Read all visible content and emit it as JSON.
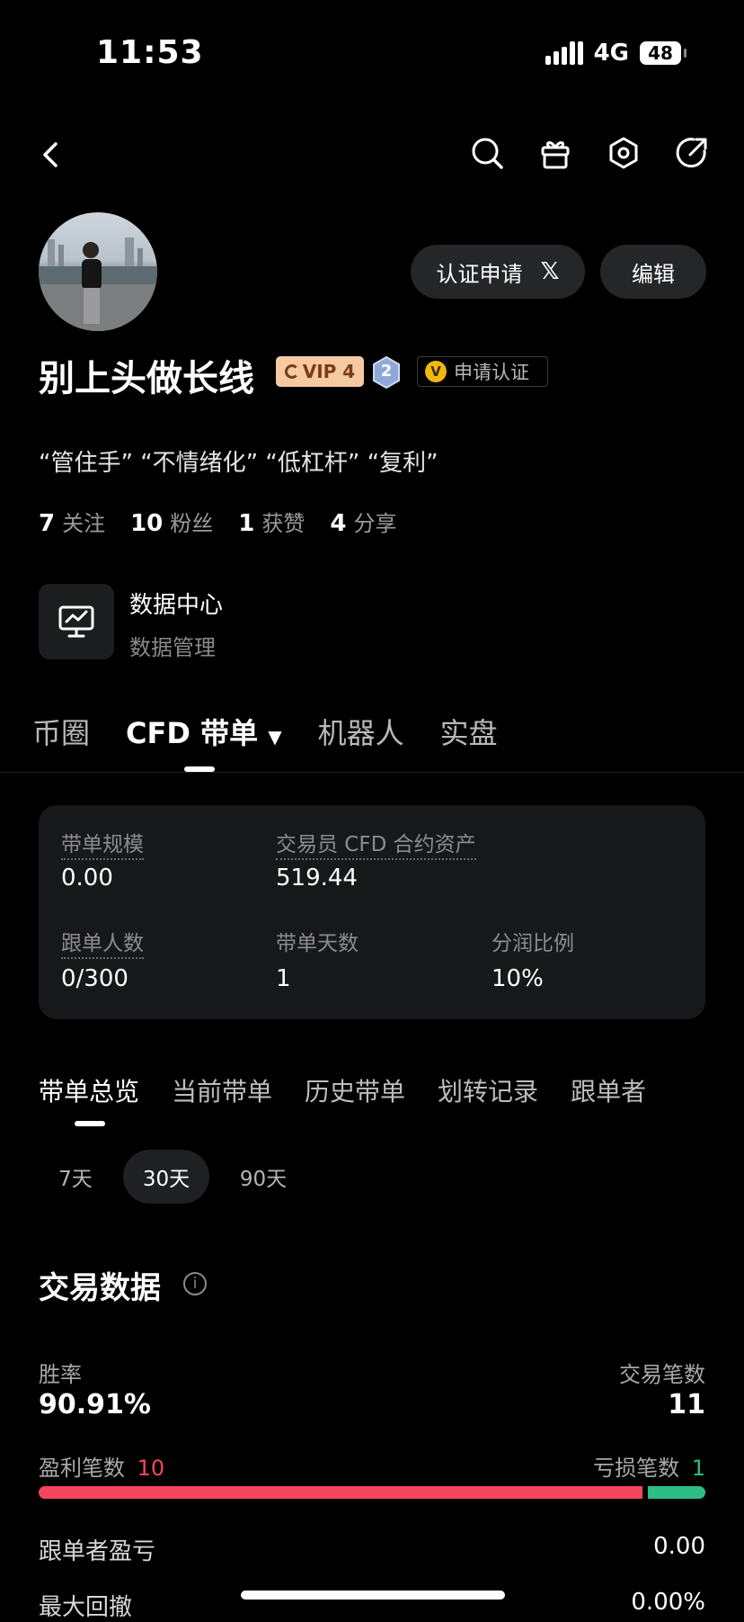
{
  "status_bar": {
    "time": "11:53",
    "network": "4G",
    "battery": "48"
  },
  "profile": {
    "name": "别上头做长线",
    "vip_label": "VIP 4",
    "level_badge": "2",
    "apply_cert_badge": "申请认证",
    "v_mark": "V",
    "bio": "“管住手”  “不情绪化”  “低杠杆”  “复利”",
    "stats": [
      {
        "num": "7",
        "label": "关注"
      },
      {
        "num": "10",
        "label": "粉丝"
      },
      {
        "num": "1",
        "label": "获赞"
      },
      {
        "num": "4",
        "label": "分享"
      }
    ]
  },
  "buttons": {
    "cert_apply": "认证申请",
    "x_mark": "𝕏",
    "edit": "编辑"
  },
  "data_center": {
    "title": "数据中心",
    "subtitle": "数据管理"
  },
  "main_tabs": [
    "币圈",
    "CFD 带单",
    "机器人",
    "实盘"
  ],
  "card": {
    "scale_label": "带单规模",
    "scale_value": "0.00",
    "asset_label": "交易员 CFD 合约资产",
    "asset_value": "519.44",
    "followers_label": "跟单人数",
    "followers_value": "0/300",
    "days_label": "带单天数",
    "days_value": "1",
    "share_label": "分润比例",
    "share_value": "10%"
  },
  "sub_tabs": [
    "带单总览",
    "当前带单",
    "历史带单",
    "划转记录",
    "跟单者"
  ],
  "ranges": [
    "7天",
    "30天",
    "90天"
  ],
  "trade_data": {
    "title": "交易数据",
    "info_glyph": "i",
    "win_rate_label": "胜率",
    "win_rate": "90.91%",
    "trades_label": "交易笔数",
    "trades": "11",
    "profit_label": "盈利笔数",
    "profit_count": "10",
    "loss_label": "亏损笔数",
    "loss_count": "1",
    "win_fraction": 0.9091,
    "follower_pnl_label": "跟单者盈亏",
    "follower_pnl": "0.00",
    "max_drawdown_label": "最大回撤",
    "max_drawdown": "0.00%"
  },
  "colors": {
    "profit": "#f6465d",
    "loss": "#2ebd85",
    "vip": "#f5c9a2",
    "accent": "#f0b90b"
  }
}
